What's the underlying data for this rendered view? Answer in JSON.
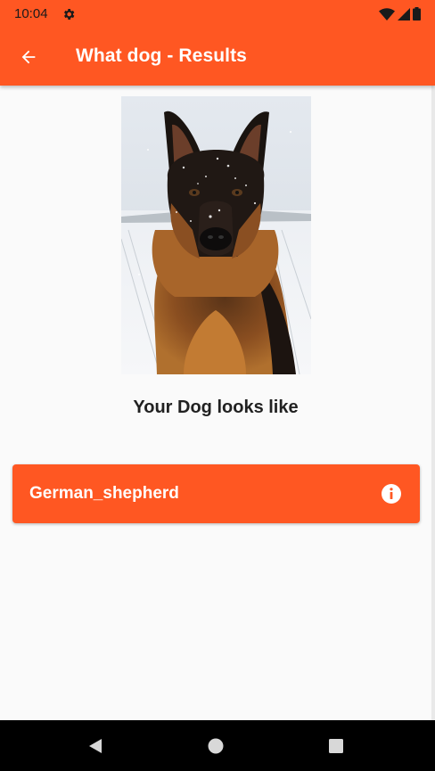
{
  "status_bar": {
    "time": "10:04",
    "icons": [
      "gear-icon",
      "wifi-icon",
      "signal-icon",
      "battery-icon"
    ]
  },
  "toolbar": {
    "title": "What dog - Results",
    "back_icon": "arrow-left-icon",
    "background": "#ff5722"
  },
  "main": {
    "photo_subject": "german-shepherd-dog-photo",
    "heading": "Your Dog looks like",
    "result": {
      "label": "German_shepherd",
      "icon": "info-icon",
      "background": "#ff5722"
    }
  },
  "nav_bar": {
    "buttons": [
      "nav-back-icon",
      "nav-home-icon",
      "nav-recents-icon"
    ]
  }
}
